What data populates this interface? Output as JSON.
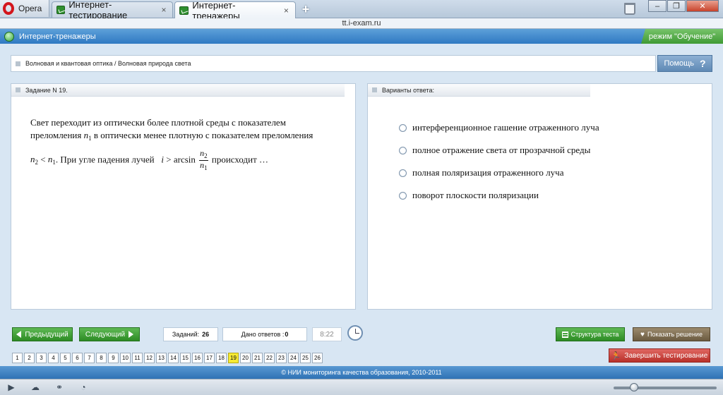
{
  "browser": {
    "menu_label": "Opera",
    "tabs": [
      {
        "label": "Интернет-тестирование",
        "active": false
      },
      {
        "label": "Интернет-тренажеры",
        "active": true
      }
    ],
    "new_tab_glyph": "+",
    "close_glyph": "×",
    "address": "tt.i-exam.ru",
    "window_controls": {
      "minimize": "–",
      "maximize": "❐",
      "close": "✕"
    }
  },
  "header": {
    "title": "Интернет-тренажеры",
    "mode": "режим \"Обучение\""
  },
  "breadcrumb": "Волновая и квантовая оптика / Волновая природа света",
  "help": {
    "label": "Помощь",
    "icon": "?"
  },
  "task": {
    "header": "Задание N 19.",
    "line1": "Свет переходит из оптически более плотной среды с показателем",
    "line2_pre": "преломления",
    "line2_post": "в оптически менее плотную с показателем преломления",
    "var_n": "n",
    "sub1": "1",
    "sub2": "2",
    "lt": "<",
    "line3_mid": ". При угле падения лучей",
    "var_i": "i",
    "gt_arcsin": "> arcsin",
    "line3_end": "происходит …"
  },
  "answers": {
    "header": "Варианты ответа:",
    "options": [
      "интерференционное гашение отраженного луча",
      "полное отражение света от прозрачной среды",
      "полная поляризация отраженного луча",
      "поворот плоскости поляризации"
    ]
  },
  "nav": {
    "prev": "Предыдущий",
    "next": "Следующий"
  },
  "stats": {
    "tasks_label": "Заданий:",
    "tasks_value": "26",
    "answered_label": "Дано ответов :",
    "answered_value": "0",
    "timer": "8:22"
  },
  "actions": {
    "structure": "Структура теста",
    "show_solution": "Показать решение",
    "finish": "Завершить тестирование"
  },
  "pages": {
    "items": [
      "1",
      "2",
      "3",
      "4",
      "5",
      "6",
      "7",
      "8",
      "9",
      "10",
      "11",
      "12",
      "13",
      "14",
      "15",
      "16",
      "17",
      "18",
      "19",
      "20",
      "21",
      "22",
      "23",
      "24",
      "25",
      "26"
    ],
    "current": "19",
    "highlight_color": "#f7ea33"
  },
  "footer": "© НИИ мониторинга качества образования, 2010-2011",
  "statusbar_icons": [
    "panel-toggle-icon",
    "cloud-icon",
    "share-icon",
    "speed-icon"
  ],
  "zoom_level_fraction": 0.2
}
